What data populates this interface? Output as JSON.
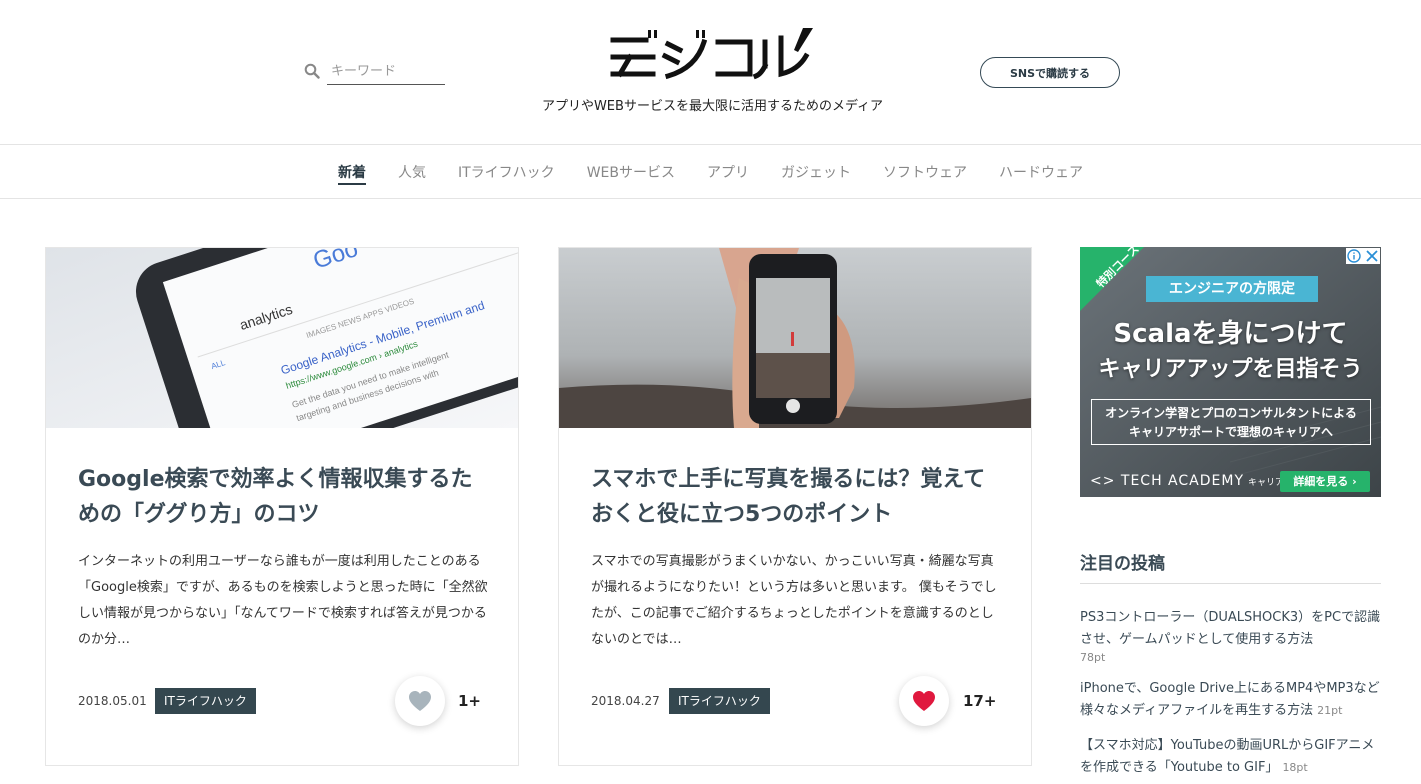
{
  "header": {
    "search_placeholder": "キーワード",
    "tagline": "アプリやWEBサービスを最大限に活用するためのメディア",
    "sns_button": "SNSで購読する"
  },
  "nav": {
    "items": [
      "新着",
      "人気",
      "ITライフハック",
      "WEBサービス",
      "アプリ",
      "ガジェット",
      "ソフトウェア",
      "ハードウェア"
    ],
    "active": "新着"
  },
  "cards": [
    {
      "title": "Google検索で効率よく情報収集するための「ググり方」のコツ",
      "excerpt": "インターネットの利用ユーザーなら誰もが一度は利用したことのある「Google検索」ですが、あるものを検索しようと思った時に「全然欲しい情報が見つからない」「なんてワードで検索すれば答えが見つかるのか分…",
      "date": "2018.05.01",
      "category": "ITライフハック",
      "likes": "1+",
      "liked": false,
      "thumb_icon": "google-search-photo-icon"
    },
    {
      "title": "スマホで上手に写真を撮るには？覚えておくと役に立つ5つのポイント",
      "excerpt": "スマホでの写真撮影がうまくいかない、かっこいい写真・綺麗な写真が撮れるようになりたい！という方は多いと思います。 僕もそうでしたが、この記事でご紹介するちょっとしたポイントを意識するのとしないのとでは…",
      "date": "2018.04.27",
      "category": "ITライフハック",
      "likes": "17+",
      "liked": true,
      "thumb_icon": "smartphone-photo-icon"
    }
  ],
  "ad": {
    "badge": "特別コース",
    "tag": "エンジニアの方限定",
    "headline1": "Scalaを身につけて",
    "headline2": "キャリアアップを目指そう",
    "box_line1": "オンライン学習とプロのコンサルタントによる",
    "box_line2": "キャリアサポートで理想のキャリアへ",
    "brand": "<> TECH ACADEMY",
    "brand_sub": "キャリア",
    "cta": "詳細を見る ›"
  },
  "sidebar": {
    "title": "注目の投稿",
    "posts": [
      {
        "title": "PS3コントローラー（DUALSHOCK3）をPCで認識させ、ゲームパッドとして使用する方法",
        "points": "78pt"
      },
      {
        "title": "iPhoneで、Google Drive上にあるMP4やMP3など様々なメディアファイルを再生する方法",
        "points": "21pt"
      },
      {
        "title": "【スマホ対応】YouTubeの動画URLからGIFアニメを作成できる「Youtube to GIF」",
        "points": "18pt"
      }
    ]
  },
  "colors": {
    "accent": "#34474f",
    "like_active": "#e0183e",
    "like_inactive": "#a8b4bc",
    "ad_green": "#26b36b",
    "ad_blue": "#4ab5d3"
  }
}
